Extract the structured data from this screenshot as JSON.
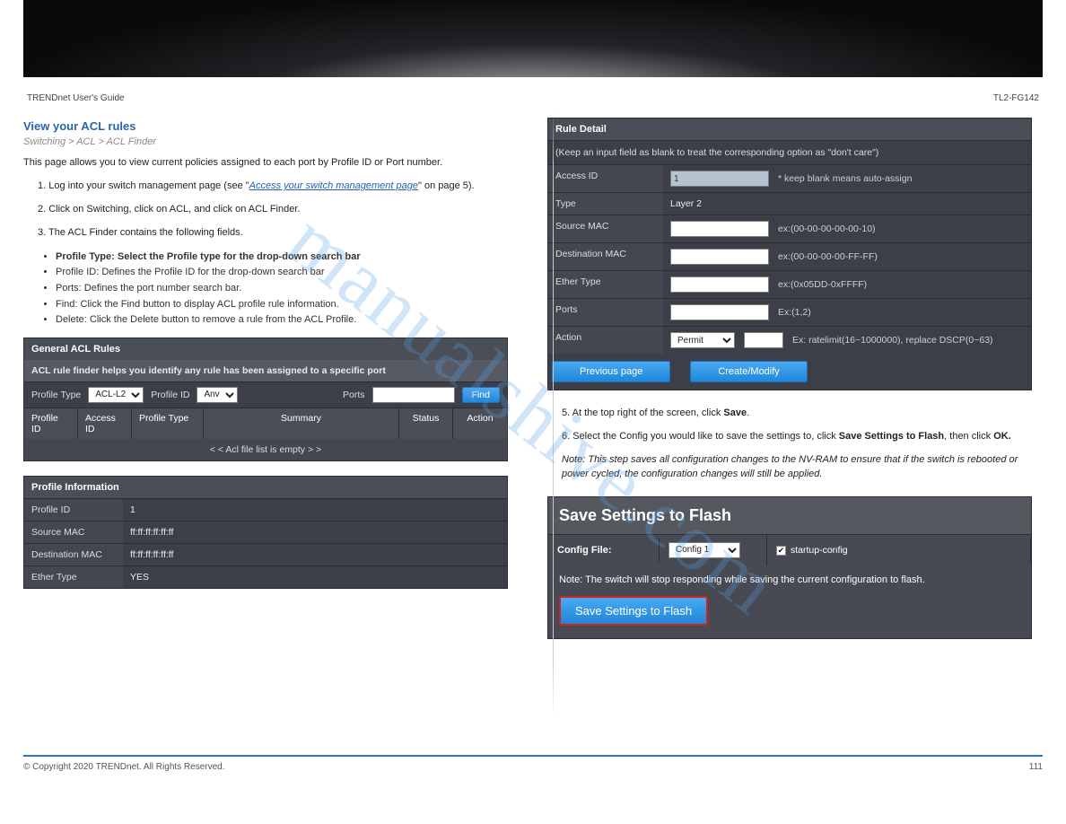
{
  "doc": {
    "brand": "TRENDnet User's Guide",
    "model": "TL2-FG142",
    "copyright": "© Copyright 2020 TRENDnet. All Rights Reserved.",
    "page": "111"
  },
  "left": {
    "heading": "View your ACL rules",
    "crumb": "Switching > ACL > ACL Finder",
    "intro": "This page allows you to view current policies assigned to each port by Profile ID or Port number.",
    "link": "Access your switch management page",
    "steps": {
      "s1a": "1. Log into your switch management page (see \"",
      "s1b": "\" on page 5).",
      "s2": "2. Click on Switching, click on ACL, and click on ACL Finder.",
      "s3": "3. The ACL Finder contains the following fields.",
      "b1": "Profile Type: Select the Profile type for the drop-down search bar",
      "b2": "Profile ID: Defines the Profile ID for the drop-down search bar",
      "b3": "Ports: Defines the port number search bar.",
      "b4": "Find: Click the Find button to display ACL profile rule information.",
      "b5": "Delete: Click the Delete button to remove a rule from the ACL Profile."
    },
    "aclRules": {
      "title": "General ACL Rules",
      "subtitle": "ACL rule finder helps you identify any rule has been assigned to a specific port",
      "profileTypeLabel": "Profile Type",
      "profileTypeValue": "ACL-L2",
      "profileIdLabel": "Profile ID",
      "profileIdValue": "Anv",
      "portsLabel": "Ports",
      "findLabel": "Find",
      "headers": {
        "profileId": "Profile ID",
        "accessId": "Access ID",
        "profileType": "Profile Type",
        "summary": "Summary",
        "status": "Status",
        "action": "Action"
      },
      "empty": "< < Acl file list is empty > >"
    },
    "profileInfo": {
      "title": "Profile Information",
      "rows": {
        "profileId": {
          "k": "Profile ID",
          "v": "1"
        },
        "srcMac": {
          "k": "Source MAC",
          "v": "ff:ff:ff:ff:ff:ff"
        },
        "dstMac": {
          "k": "Destination MAC",
          "v": "ff:ff:ff:ff:ff:ff"
        },
        "etherType": {
          "k": "Ether Type",
          "v": "YES"
        }
      }
    }
  },
  "right": {
    "ruleDetail": {
      "title": "Rule Detail",
      "hint": "(Keep an input field as blank to treat the corresponding option as \"don't care\")",
      "rows": {
        "accessId": {
          "k": "Access ID",
          "val": "1",
          "note": "* keep blank means auto-assign"
        },
        "type": {
          "k": "Type",
          "val": "Layer 2"
        },
        "srcMac": {
          "k": "Source MAC",
          "note": "ex:(00-00-00-00-00-10)"
        },
        "dstMac": {
          "k": "Destination MAC",
          "note": "ex:(00-00-00-00-FF-FF)"
        },
        "etherType": {
          "k": "Ether Type",
          "note": "ex:(0x05DD-0xFFFF)"
        },
        "ports": {
          "k": "Ports",
          "note": "Ex:(1,2)"
        },
        "action": {
          "k": "Action",
          "sel": "Permit",
          "note": "Ex: ratelimit(16~1000000), replace DSCP(0~63)"
        }
      },
      "prev": "Previous page",
      "create": "Create/Modify"
    },
    "saveSteps": {
      "s5a": "5. At the top right of the screen, click ",
      "s5bold": "Save",
      "s5b": ".",
      "s6a": "6. Select the Config you would like to save the settings to, click ",
      "s6bold": "Save Settings to Flash",
      "s6b": ", then click ",
      "s6bold2": "OK.",
      "note": "Note: This step saves all configuration changes to the NV-RAM to ensure that if the switch is rebooted or power cycled, the configuration changes will still be applied."
    },
    "savePanel": {
      "title": "Save Settings to Flash",
      "configLabel": "Config File:",
      "configValue": "Config 1",
      "startup": "startup-config",
      "note": "Note: The switch will stop responding while saving the current configuration to flash.",
      "btn": "Save Settings to Flash"
    }
  },
  "watermark": "manualshive.com"
}
